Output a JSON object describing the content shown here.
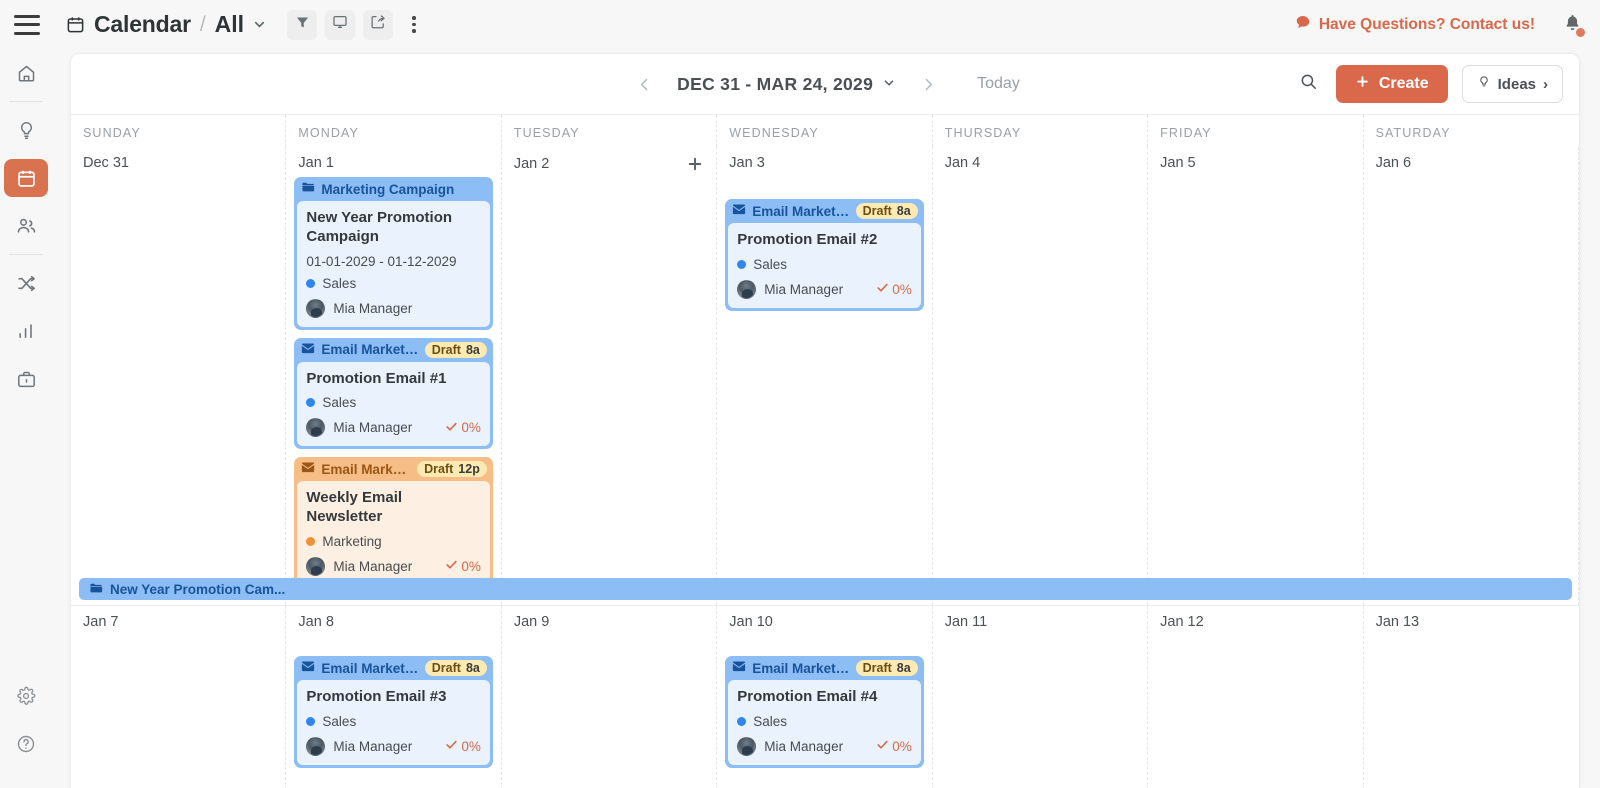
{
  "topbar": {
    "menu_icon": "hamburger-icon",
    "calendar_icon": "calendar-icon",
    "title": "Calendar",
    "separator": "/",
    "scope": "All",
    "chevron_icon": "chevron-down-icon",
    "buttons": [
      {
        "name": "filter-button",
        "icon": "filter-icon"
      },
      {
        "name": "display-button",
        "icon": "monitor-icon"
      },
      {
        "name": "share-button",
        "icon": "share-icon"
      }
    ],
    "more_icon": "more-vertical-icon",
    "contact_text": "Have Questions? Contact us!",
    "contact_icon": "chat-bubble-icon",
    "bell_icon": "bell-icon",
    "accent_color": "#d9694a"
  },
  "sidebar": {
    "items": [
      {
        "name": "sidebar-item-home",
        "icon": "home-icon",
        "active": false
      },
      {
        "name": "sidebar-item-ideas",
        "icon": "lightbulb-icon",
        "active": false
      },
      {
        "name": "sidebar-item-calendar",
        "icon": "calendar-icon",
        "active": true
      },
      {
        "name": "sidebar-item-people",
        "icon": "people-icon",
        "active": false
      },
      {
        "name": "sidebar-item-workflow",
        "icon": "shuffle-icon",
        "active": false
      },
      {
        "name": "sidebar-item-reports",
        "icon": "bar-chart-icon",
        "active": false
      },
      {
        "name": "sidebar-item-portfolio",
        "icon": "briefcase-icon",
        "active": false
      }
    ],
    "bottom_items": [
      {
        "name": "sidebar-item-settings",
        "icon": "gear-icon"
      },
      {
        "name": "sidebar-item-help",
        "icon": "help-circle-icon"
      }
    ],
    "active_color": "#d9724f"
  },
  "calendar_toolbar": {
    "prev_icon": "chevron-left-icon",
    "next_icon": "chevron-right-icon",
    "date_range": "DEC 31 - MAR 24, 2029",
    "range_chevron_icon": "chevron-down-icon",
    "today_label": "Today",
    "search_icon": "search-icon",
    "create_label": "Create",
    "create_icon": "plus-icon",
    "ideas_label": "Ideas",
    "ideas_icon": "lightbulb-icon",
    "ideas_chevron": "›"
  },
  "grid": {
    "daynames": [
      "SUNDAY",
      "MONDAY",
      "TUESDAY",
      "WEDNESDAY",
      "THURSDAY",
      "FRIDAY",
      "SATURDAY"
    ],
    "week1": [
      {
        "date": "Dec 31",
        "add_icon": null
      },
      {
        "date": "Jan 1",
        "add_icon": null
      },
      {
        "date": "Jan 2",
        "add_icon": "plus-icon"
      },
      {
        "date": "Jan 3",
        "add_icon": null
      },
      {
        "date": "Jan 4",
        "add_icon": null
      },
      {
        "date": "Jan 5",
        "add_icon": null
      },
      {
        "date": "Jan 6",
        "add_icon": null
      }
    ],
    "week2": [
      {
        "date": "Jan 7"
      },
      {
        "date": "Jan 8"
      },
      {
        "date": "Jan 9"
      },
      {
        "date": "Jan 10"
      },
      {
        "date": "Jan 11"
      },
      {
        "date": "Jan 12"
      },
      {
        "date": "Jan 13"
      }
    ],
    "span_event": {
      "icon": "folder-icon",
      "label": "New Year Promotion Cam...",
      "color": "#8cbdf5"
    }
  },
  "events": {
    "mon_campaign": {
      "list": "Marketing Campaign",
      "list_icon": "folder-icon",
      "title": "New Year Promotion Campaign",
      "dates": "01-01-2029 - 01-12-2029",
      "tag": "Sales",
      "tag_color": "#2f86ed",
      "assignee": "Mia Manager",
      "theme": "blue"
    },
    "mon_email1": {
      "list": "Email Marketing",
      "list_icon": "envelope-icon",
      "badge_status": "Draft",
      "badge_time": "8a",
      "title": "Promotion Email #1",
      "tag": "Sales",
      "tag_color": "#2f86ed",
      "assignee": "Mia Manager",
      "progress": "0%",
      "check_icon": "check-icon",
      "theme": "blue"
    },
    "mon_newsletter": {
      "list": "Email Marketi...",
      "list_icon": "envelope-icon",
      "badge_status": "Draft",
      "badge_time": "12p",
      "title": "Weekly Email Newsletter",
      "tag": "Marketing",
      "tag_color": "#f19134",
      "assignee": "Mia Manager",
      "progress": "0%",
      "check_icon": "check-icon",
      "theme": "orange"
    },
    "wed_email2": {
      "list": "Email Marketing",
      "list_icon": "envelope-icon",
      "badge_status": "Draft",
      "badge_time": "8a",
      "title": "Promotion Email #2",
      "tag": "Sales",
      "tag_color": "#2f86ed",
      "assignee": "Mia Manager",
      "progress": "0%",
      "check_icon": "check-icon",
      "theme": "blue"
    },
    "mon2_email3": {
      "list": "Email Marketing",
      "list_icon": "envelope-icon",
      "badge_status": "Draft",
      "badge_time": "8a",
      "title": "Promotion Email #3",
      "tag": "Sales",
      "tag_color": "#2f86ed",
      "assignee": "Mia Manager",
      "progress": "0%",
      "check_icon": "check-icon",
      "theme": "blue"
    },
    "wed2_email4": {
      "list": "Email Marketing",
      "list_icon": "envelope-icon",
      "badge_status": "Draft",
      "badge_time": "8a",
      "title": "Promotion Email #4",
      "tag": "Sales",
      "tag_color": "#2f86ed",
      "assignee": "Mia Manager",
      "progress": "0%",
      "check_icon": "check-icon",
      "theme": "blue"
    }
  }
}
